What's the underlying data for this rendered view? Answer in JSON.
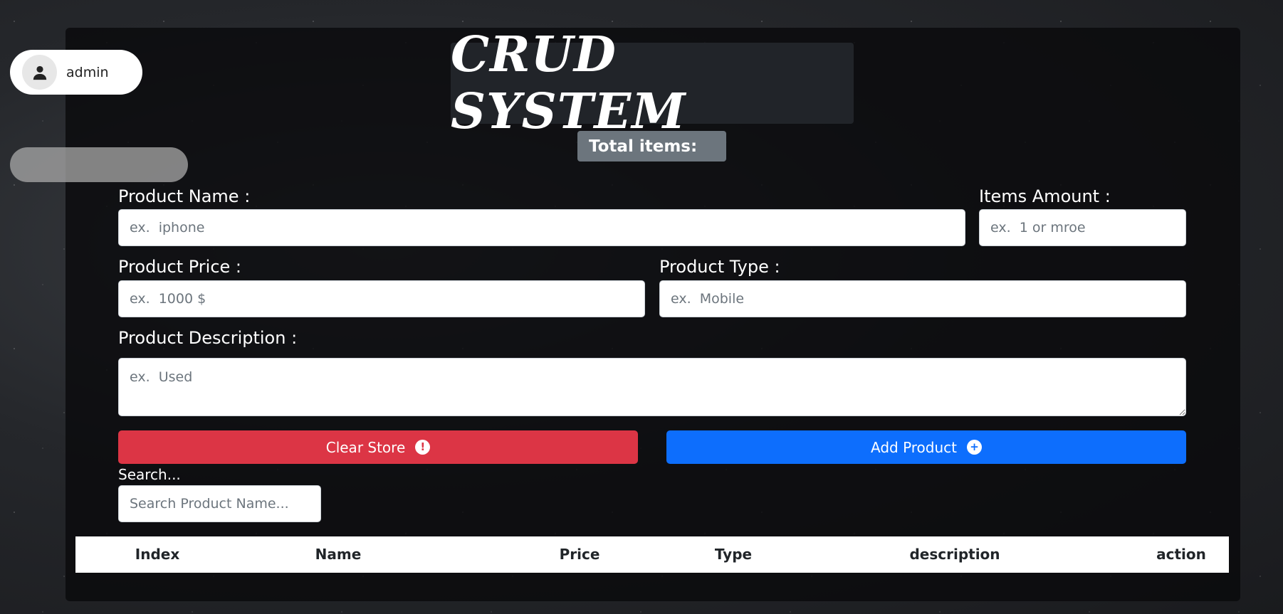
{
  "user": {
    "name": "admin"
  },
  "header": {
    "title": "CRUD SYSTEM",
    "total_label": "Total items:"
  },
  "form": {
    "product_name": {
      "label": "Product Name :",
      "placeholder": "ex.  iphone"
    },
    "items_amount": {
      "label": "Items Amount :",
      "placeholder": "ex.  1 or mroe"
    },
    "product_price": {
      "label": "Product Price :",
      "placeholder": "ex.  1000 $"
    },
    "product_type": {
      "label": "Product Type :",
      "placeholder": "ex.  Mobile"
    },
    "product_description": {
      "label": "Product Description :",
      "placeholder": "ex.  Used"
    }
  },
  "buttons": {
    "clear_store": "Clear Store",
    "add_product": "Add Product"
  },
  "search": {
    "label": "Search...",
    "placeholder": "Search Product Name..."
  },
  "table": {
    "columns": [
      "Index",
      "Name",
      "Price",
      "Type",
      "description",
      "action"
    ]
  },
  "colors": {
    "danger": "#dc3545",
    "primary": "#0d6efd",
    "badge": "#6c757d"
  }
}
